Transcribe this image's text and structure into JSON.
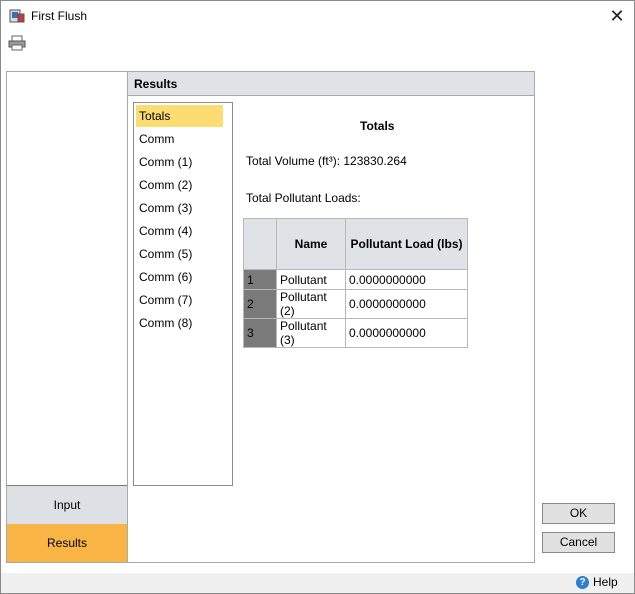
{
  "window": {
    "title": "First Flush",
    "close_glyph": "✕"
  },
  "toolbar": {
    "print_icon": "printer-icon"
  },
  "nav": {
    "input_label": "Input",
    "results_label": "Results",
    "active_color": "#f8b546"
  },
  "results": {
    "header": "Results",
    "list": [
      "Totals",
      "Comm",
      "Comm (1)",
      "Comm (2)",
      "Comm (3)",
      "Comm (4)",
      "Comm (5)",
      "Comm (6)",
      "Comm (7)",
      "Comm (8)"
    ],
    "selected_index": 0,
    "selected_color": "#fcdd73",
    "detail": {
      "title": "Totals",
      "total_volume": "Total Volume (ft³): 123830.264",
      "loads_label": "Total Pollutant Loads:",
      "table": {
        "columns": [
          "Name",
          "Pollutant Load (lbs)"
        ],
        "rows": [
          {
            "num": "1",
            "name": "Pollutant",
            "load": "0.0000000000"
          },
          {
            "num": "2",
            "name": "Pollutant (2)",
            "load": "0.0000000000"
          },
          {
            "num": "3",
            "name": "Pollutant (3)",
            "load": "0.0000000000"
          }
        ]
      }
    }
  },
  "buttons": {
    "ok": "OK",
    "cancel": "Cancel"
  },
  "status": {
    "help": "Help"
  }
}
